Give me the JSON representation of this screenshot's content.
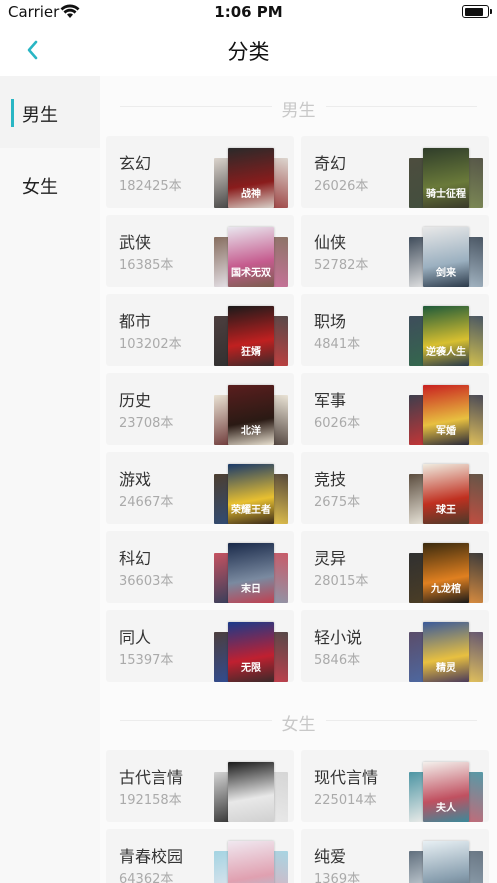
{
  "status_bar": {
    "carrier": "Carrier",
    "time": "1:06 PM",
    "battery_level": 0.85
  },
  "nav": {
    "title": "分类"
  },
  "sidebar": {
    "items": [
      {
        "label": "男生",
        "active": true
      },
      {
        "label": "女生",
        "active": false
      }
    ]
  },
  "sections": [
    {
      "title": "男生",
      "categories": [
        {
          "name": "玄幻",
          "count": "182425本",
          "cover_text": "战神",
          "colors": [
            "#2a2a2a",
            "#8a1c1c",
            "#d8d0c8"
          ]
        },
        {
          "name": "奇幻",
          "count": "26026本",
          "cover_text": "骑士征程",
          "colors": [
            "#2f3d2a",
            "#6a7a3a",
            "#3a3a2a"
          ]
        },
        {
          "name": "武侠",
          "count": "16385本",
          "cover_text": "国术无双",
          "colors": [
            "#e9e6ee",
            "#c55b8e",
            "#7a5e4e"
          ]
        },
        {
          "name": "仙侠",
          "count": "52782本",
          "cover_text": "剑来",
          "colors": [
            "#e8e8e8",
            "#9bb0c0",
            "#2c3a4a"
          ]
        },
        {
          "name": "都市",
          "count": "103202本",
          "cover_text": "狂婿",
          "colors": [
            "#1a1a1a",
            "#c02020",
            "#3a2a2a"
          ]
        },
        {
          "name": "职场",
          "count": "4841本",
          "cover_text": "逆袭人生",
          "colors": [
            "#1e5a3a",
            "#d8c030",
            "#2a3a4a"
          ]
        },
        {
          "name": "历史",
          "count": "23708本",
          "cover_text": "北洋",
          "colors": [
            "#5a1e1e",
            "#2a1a14",
            "#e8e0d0"
          ]
        },
        {
          "name": "军事",
          "count": "6026本",
          "cover_text": "军婚",
          "colors": [
            "#c82020",
            "#e8c040",
            "#2a2a3a"
          ]
        },
        {
          "name": "游戏",
          "count": "24667本",
          "cover_text": "荣耀王者",
          "colors": [
            "#1a3a6a",
            "#e8c030",
            "#3a2a1a"
          ]
        },
        {
          "name": "竞技",
          "count": "2675本",
          "cover_text": "球王",
          "colors": [
            "#f0ece0",
            "#c03020",
            "#4a3a2a"
          ]
        },
        {
          "name": "科幻",
          "count": "36603本",
          "cover_text": "末日",
          "colors": [
            "#1a2a4a",
            "#7a8aa0",
            "#c04050"
          ]
        },
        {
          "name": "灵异",
          "count": "28015本",
          "cover_text": "九龙棺",
          "colors": [
            "#3a2a0e",
            "#e08020",
            "#1a1a1a"
          ]
        },
        {
          "name": "同人",
          "count": "15397本",
          "cover_text": "无限",
          "colors": [
            "#1a3a8a",
            "#c02030",
            "#3a2a2a"
          ]
        },
        {
          "name": "轻小说",
          "count": "5846本",
          "cover_text": "精灵",
          "colors": [
            "#3a5a9a",
            "#e8c040",
            "#4a3a5a"
          ]
        }
      ]
    },
    {
      "title": "女生",
      "categories": [
        {
          "name": "古代言情",
          "count": "192158本",
          "cover_text": "",
          "colors": [
            "#1a1a1a",
            "#e8e8e8",
            "#d0d0d0"
          ]
        },
        {
          "name": "现代言情",
          "count": "225014本",
          "cover_text": "夫人",
          "colors": [
            "#f4f0ec",
            "#c05060",
            "#3a8a9a"
          ]
        },
        {
          "name": "青春校园",
          "count": "64362本",
          "cover_text": "",
          "colors": [
            "#f0e8f0",
            "#e0a0b0",
            "#9ad0e0"
          ]
        },
        {
          "name": "纯爱",
          "count": "1369本",
          "cover_text": "",
          "colors": [
            "#e8f0f4",
            "#8aa0b0",
            "#506070"
          ]
        }
      ]
    }
  ]
}
